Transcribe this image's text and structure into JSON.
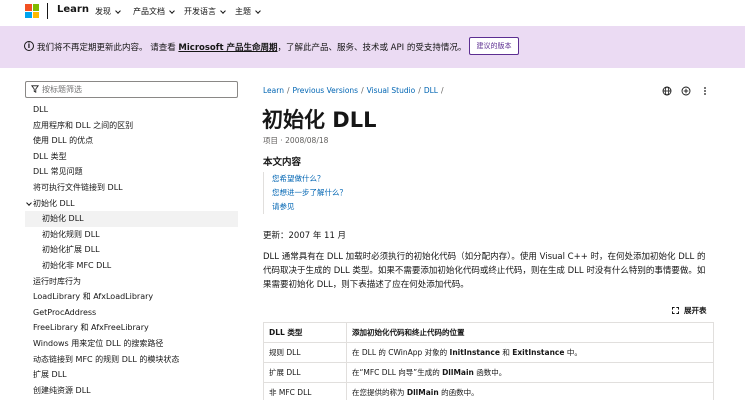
{
  "topnav": {
    "learn": "Learn",
    "items": [
      {
        "label": "发现"
      },
      {
        "label": "产品文档"
      },
      {
        "label": "开发语言"
      },
      {
        "label": "主题"
      }
    ]
  },
  "colors": {
    "logo": [
      "#f25022",
      "#7fba00",
      "#00a4ef",
      "#ffb900"
    ],
    "banner_bg": "#ebdbf3",
    "link": "#0065b3"
  },
  "banner": {
    "text_before": "我们将不再定期更新此内容。 请查看 ",
    "link": "Microsoft 产品生命周期",
    "text_after": "，了解此产品、服务、技术或 API 的受支持情况。",
    "button": "建议的版本"
  },
  "sidebar": {
    "filter_placeholder": "按标题筛选",
    "items": [
      {
        "label": "DLL"
      },
      {
        "label": "应用程序和 DLL 之间的区别"
      },
      {
        "label": "使用 DLL 的优点"
      },
      {
        "label": "DLL 类型"
      },
      {
        "label": "DLL 常见问题"
      },
      {
        "label": "将可执行文件链接到 DLL"
      },
      {
        "label": "初始化 DLL"
      },
      {
        "label": "初始化 DLL"
      },
      {
        "label": "初始化规则 DLL"
      },
      {
        "label": "初始化扩展 DLL"
      },
      {
        "label": "初始化非 MFC DLL"
      },
      {
        "label": "运行时库行为"
      },
      {
        "label": "LoadLibrary 和 AfxLoadLibrary"
      },
      {
        "label": "GetProcAddress"
      },
      {
        "label": "FreeLibrary 和 AfxFreeLibrary"
      },
      {
        "label": "Windows 用来定位 DLL 的搜索路径"
      },
      {
        "label": "动态链接到 MFC 的规则 DLL 的模块状态"
      },
      {
        "label": "扩展 DLL"
      },
      {
        "label": "创建纯资源 DLL"
      }
    ]
  },
  "breadcrumb": [
    "Learn",
    "Previous Versions",
    "Visual Studio",
    "DLL"
  ],
  "main": {
    "title": "初始化 DLL",
    "meta_type": "项目",
    "meta_date": "2008/08/18",
    "toc_heading": "本文内容",
    "in_page_links": [
      "您希望做什么？",
      "您想进一步了解什么？",
      "请参见"
    ],
    "updated": "更新：2007 年 11 月",
    "paragraph": "DLL 通常具有在 DLL 加载时必须执行的初始化代码（如分配内存）。使用 Visual C++ 时，在何处添加初始化 DLL 的代码取决于生成的 DLL 类型。如果不需要添加初始化代码或终止代码，则在生成 DLL 时没有什么特别的事情要做。如果需要初始化 DLL，则下表描述了应在何处添加代码。",
    "expand_table": "展开表"
  },
  "table": {
    "headers": [
      "DLL 类型",
      "添加初始化代码和终止代码的位置"
    ],
    "rows": [
      {
        "type": "规则 DLL",
        "pre": "在 DLL 的 CWinApp 对象的 ",
        "b1": "InitInstance",
        "mid": " 和 ",
        "b2": "ExitInstance",
        "post": " 中。"
      },
      {
        "type": "扩展 DLL",
        "pre": "在“MFC DLL 向导”生成的 ",
        "b1": "DllMain",
        "mid": " 函数中。",
        "b2": "",
        "post": ""
      },
      {
        "type": "非 MFC DLL",
        "pre": "在您提供的称为 ",
        "b1": "DllMain",
        "mid": " 的函数中。",
        "b2": "",
        "post": ""
      }
    ]
  }
}
